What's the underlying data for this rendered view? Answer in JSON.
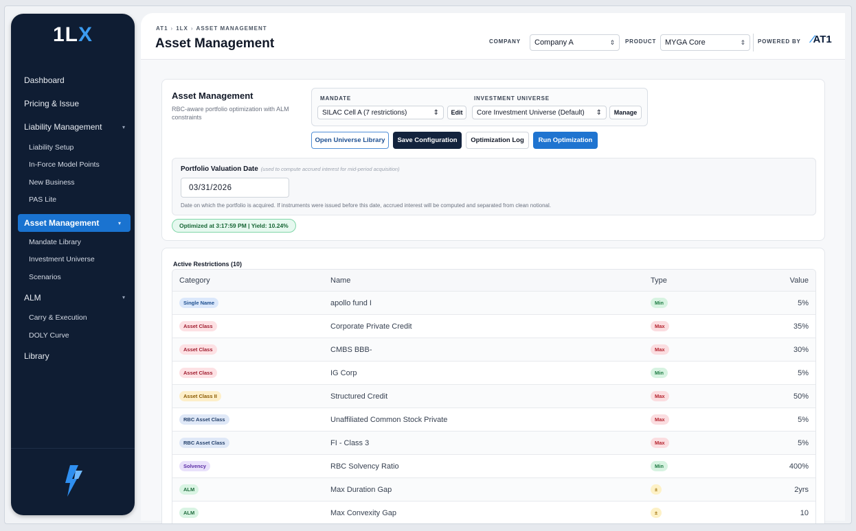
{
  "sidebar": {
    "logo_prefix": "1L",
    "logo_suffix": "X",
    "items": [
      {
        "label": "Dashboard"
      },
      {
        "label": "Pricing & Issue"
      },
      {
        "label": "Liability Management"
      },
      {
        "label": "Liability Setup"
      },
      {
        "label": "In-Force Model Points"
      },
      {
        "label": "New Business"
      },
      {
        "label": "PAS Lite"
      },
      {
        "label": "Asset Management"
      },
      {
        "label": "Mandate Library"
      },
      {
        "label": "Investment Universe"
      },
      {
        "label": "Scenarios"
      },
      {
        "label": "ALM"
      },
      {
        "label": "Carry & Execution"
      },
      {
        "label": "DOLY Curve"
      },
      {
        "label": "Library"
      }
    ]
  },
  "header": {
    "breadcrumb": [
      "AT1",
      "1LX",
      "ASSET MANAGEMENT"
    ],
    "title": "Asset Management",
    "company_label": "COMPANY",
    "company_value": "Company A",
    "product_label": "PRODUCT",
    "product_value": "MYGA Core",
    "powered_by": "POWERED BY",
    "brand": "AT1"
  },
  "config": {
    "title": "Asset Management",
    "description": "RBC-aware portfolio optimization with ALM constraints",
    "mandate_label": "MANDATE",
    "mandate_value": "SILAC Cell A (7 restrictions)",
    "edit_label": "Edit",
    "universe_label": "INVESTMENT UNIVERSE",
    "universe_value": "Core Investment Universe (Default)",
    "manage_label": "Manage",
    "buttons": {
      "open_universe": "Open Universe Library",
      "save": "Save Configuration",
      "log": "Optimization Log",
      "run": "Run Optimization"
    },
    "valuation": {
      "title": "Portfolio Valuation Date",
      "hint": "(used to compute accrued interest for mid-period acquisition)",
      "date": "03/31/2026",
      "note": "Date on which the portfolio is acquired. If instruments were issued before this date, accrued interest will be computed and separated from clean notional."
    },
    "status": "Optimized at 3:17:59 PM | Yield: 10.24%"
  },
  "restrictions": {
    "title": "Active Restrictions (10)",
    "columns": [
      "Category",
      "Name",
      "Type",
      "Value"
    ],
    "rows": [
      {
        "category": "Single Name",
        "name": "apollo fund I",
        "type": "Min",
        "value": "5%"
      },
      {
        "category": "Asset Class",
        "name": "Corporate Private Credit",
        "type": "Max",
        "value": "35%"
      },
      {
        "category": "Asset Class",
        "name": "CMBS BBB-",
        "type": "Max",
        "value": "30%"
      },
      {
        "category": "Asset Class",
        "name": "IG Corp",
        "type": "Min",
        "value": "5%"
      },
      {
        "category": "Asset Class II",
        "name": "Structured Credit",
        "type": "Max",
        "value": "50%"
      },
      {
        "category": "RBC Asset Class",
        "name": "Unaffiliated Common Stock Private",
        "type": "Max",
        "value": "5%"
      },
      {
        "category": "RBC Asset Class",
        "name": "FI - Class 3",
        "type": "Max",
        "value": "5%"
      },
      {
        "category": "Solvency",
        "name": "RBC Solvency Ratio",
        "type": "Min",
        "value": "400%"
      },
      {
        "category": "ALM",
        "name": "Max Duration Gap",
        "type": "±",
        "value": "2yrs"
      },
      {
        "category": "ALM",
        "name": "Max Convexity Gap",
        "type": "±",
        "value": "10"
      }
    ]
  }
}
